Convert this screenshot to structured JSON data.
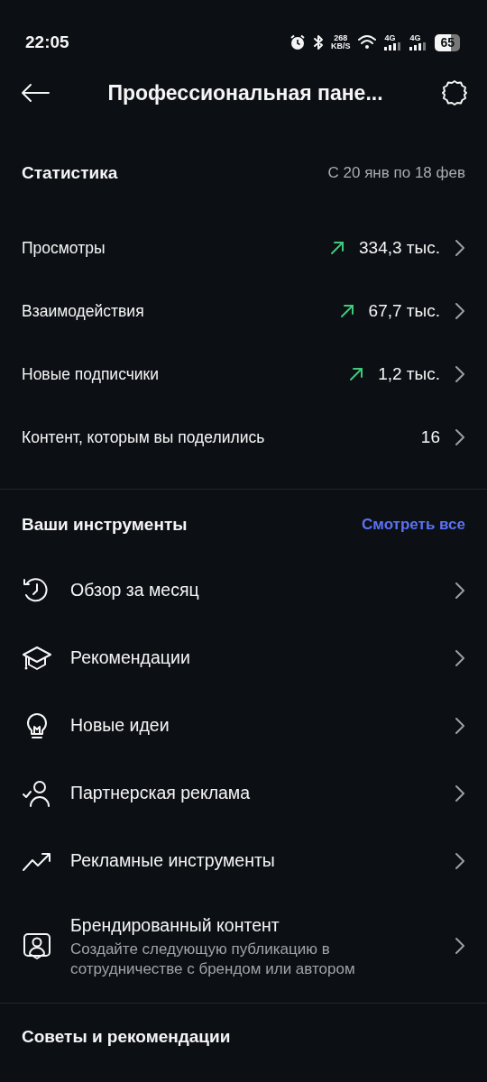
{
  "status_bar": {
    "time": "22:05",
    "speed": "268",
    "speed_unit": "KB/S",
    "network_1": "4G",
    "network_2": "4G",
    "battery": "65"
  },
  "header": {
    "title": "Профессиональная пане..."
  },
  "statistics": {
    "title": "Статистика",
    "period": "С 20 янв по 18 фев",
    "rows": [
      {
        "label": "Просмотры",
        "value": "334,3 тыс.",
        "kind": "rising"
      },
      {
        "label": "Взаимодействия",
        "value": "67,7 тыс.",
        "kind": "rising"
      },
      {
        "label": "Новые подписчики",
        "value": "1,2 тыс.",
        "kind": "rising"
      },
      {
        "label": "Контент, которым вы поделились",
        "value": "16",
        "kind": "plain"
      }
    ]
  },
  "tools": {
    "title": "Ваши инструменты",
    "see_all": "Смотреть все",
    "items": [
      {
        "label": "Обзор за месяц"
      },
      {
        "label": "Рекомендации"
      },
      {
        "label": "Новые идеи"
      },
      {
        "label": "Партнерская реклама"
      },
      {
        "label": "Рекламные инструменты"
      },
      {
        "label": "Брендированный контент",
        "description": "Создайте следующую публикацию в сотрудничестве с брендом или автором"
      }
    ]
  },
  "tips": {
    "title": "Советы и рекомендации"
  }
}
